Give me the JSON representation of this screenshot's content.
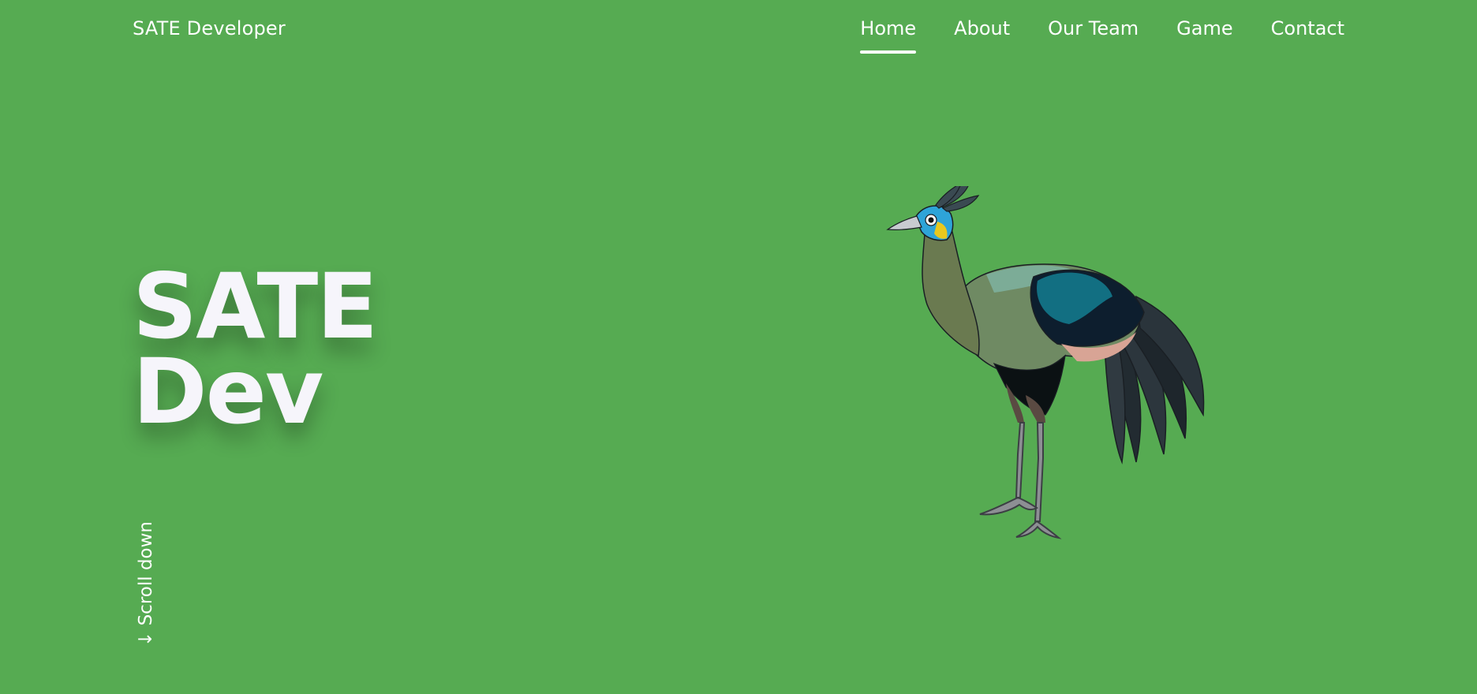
{
  "header": {
    "brand": "SATE Developer",
    "nav": [
      {
        "label": "Home",
        "active": true
      },
      {
        "label": "About",
        "active": false
      },
      {
        "label": "Our Team",
        "active": false
      },
      {
        "label": "Game",
        "active": false
      },
      {
        "label": "Contact",
        "active": false
      }
    ]
  },
  "hero": {
    "title_line1": "SATE",
    "title_line2": "Dev",
    "scroll_label": "↓ Scroll down",
    "image": "peacock-illustration"
  },
  "colors": {
    "background": "#56ab52",
    "text": "#ffffff",
    "title": "#f6f5fb"
  }
}
